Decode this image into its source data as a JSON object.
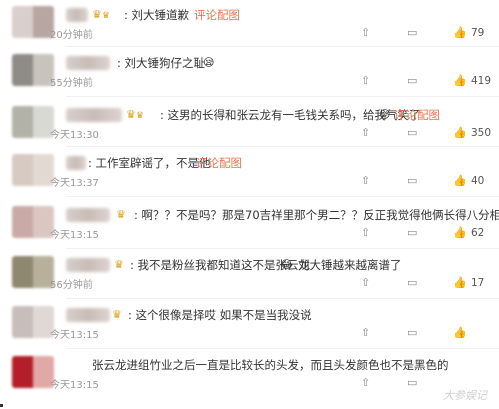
{
  "comments": [
    {
      "content": ": 刘大锤道歉",
      "link": "评论配图",
      "time": "20分钟前",
      "likes": "79",
      "avatar_colors": [
        "#d9cfcc",
        "#b7a6a2"
      ]
    },
    {
      "content": ": 刘大锤狗仔之耻",
      "emoji": "😪",
      "time": "55分钟前",
      "likes": "419",
      "avatar_colors": [
        "#8f8b86",
        "#c8c3bd"
      ]
    },
    {
      "content": ": 这男的长得和张云龙有一毛钱关系吗，给我气笑了",
      "emoji": "😜",
      "link": "评论配图",
      "time": "今天13:30",
      "likes": "350",
      "avatar_colors": [
        "#b2b2a9",
        "#d9d9d4"
      ]
    },
    {
      "content": ": 工作室辟谣了，不是他",
      "link": "评论配图",
      "time": "今天13:37",
      "likes": "40",
      "avatar_colors": [
        "#d6cac3",
        "#e3d9d3"
      ]
    },
    {
      "content": ": 啊？？不是吗？那是70吉祥里那个男二？？反正我觉得他俩长得八分相像",
      "time": "今天13:15",
      "likes": "62",
      "avatar_colors": [
        "#c9aaa6",
        "#dcc6c2"
      ]
    },
    {
      "content": ": 我不是粉丝我都知道这不是张云龙",
      "emoji": "😂",
      "content2": "刘大锤越来越离谱了",
      "time": "56分钟前",
      "likes": "17",
      "avatar_colors": [
        "#8f8770",
        "#b8b09a"
      ]
    },
    {
      "content": ": 这个很像是择哎 如果不是当我没说",
      "time": "今天13:15",
      "likes": "",
      "avatar_colors": [
        "#c7bebb",
        "#e0d8d5"
      ]
    },
    {
      "content": "张云龙进组竹业之后一直是比较长的头发，而且头发颜色也不是黑色的",
      "time": "今天13:15",
      "likes": "",
      "avatar_colors": [
        "#b31e2a",
        "#e2a8a6"
      ]
    }
  ],
  "icons": {
    "vip": "crown-icon",
    "share": "share-icon",
    "comment": "comment-icon",
    "like": "thumb-up-icon"
  },
  "watermark": "大参娱记"
}
